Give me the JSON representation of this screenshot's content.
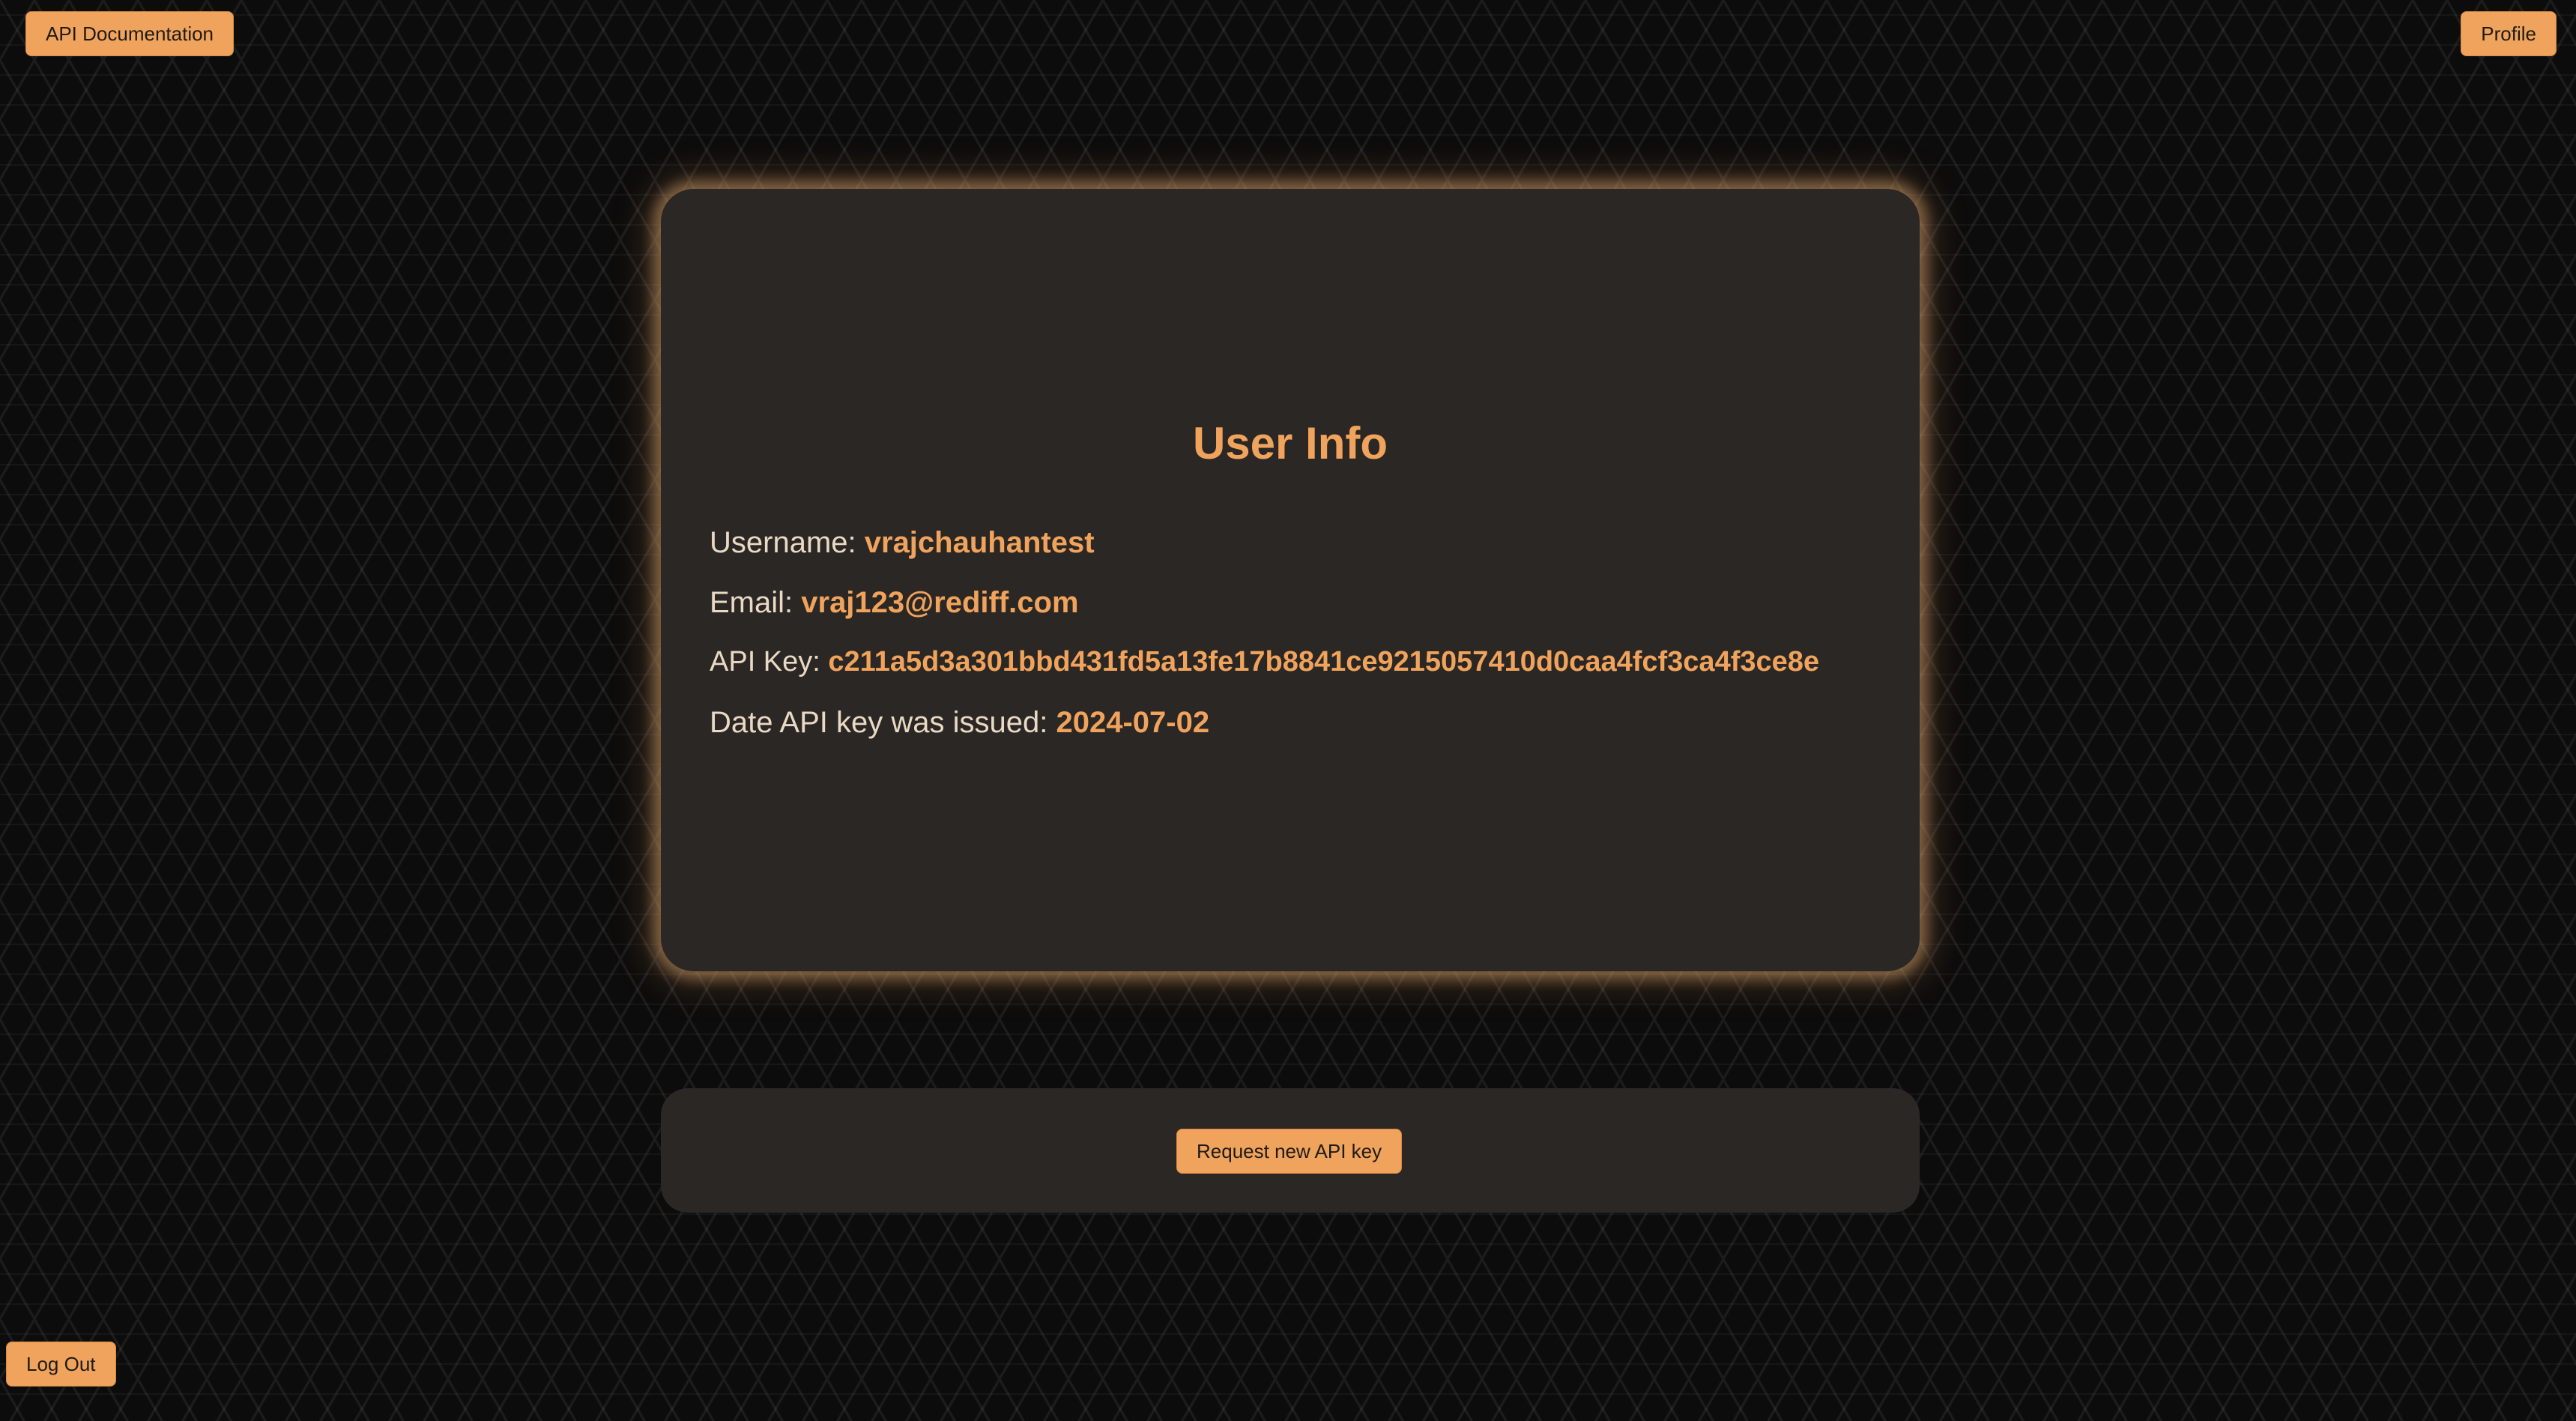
{
  "nav": {
    "api_docs_label": "API Documentation",
    "profile_label": "Profile",
    "logout_label": "Log Out"
  },
  "user_info": {
    "title": "User Info",
    "username_label": "Username: ",
    "username": "vrajchauhantest",
    "email_label": "Email: ",
    "email": "vraj123@rediff.com",
    "api_key_label": "API Key: ",
    "api_key": "c211a5d3a301bbd431fd5a13fe17b8841ce9215057410d0caa4fcf3ca4f3ce8e",
    "date_label": "Date API key was issued: ",
    "date_issued": "2024-07-02"
  },
  "actions": {
    "request_key_label": "Request new API key"
  },
  "colors": {
    "accent": "#f0a35c",
    "card_bg": "#2b2724",
    "text": "#ead9c4",
    "page_bg": "#0d0c0c"
  }
}
